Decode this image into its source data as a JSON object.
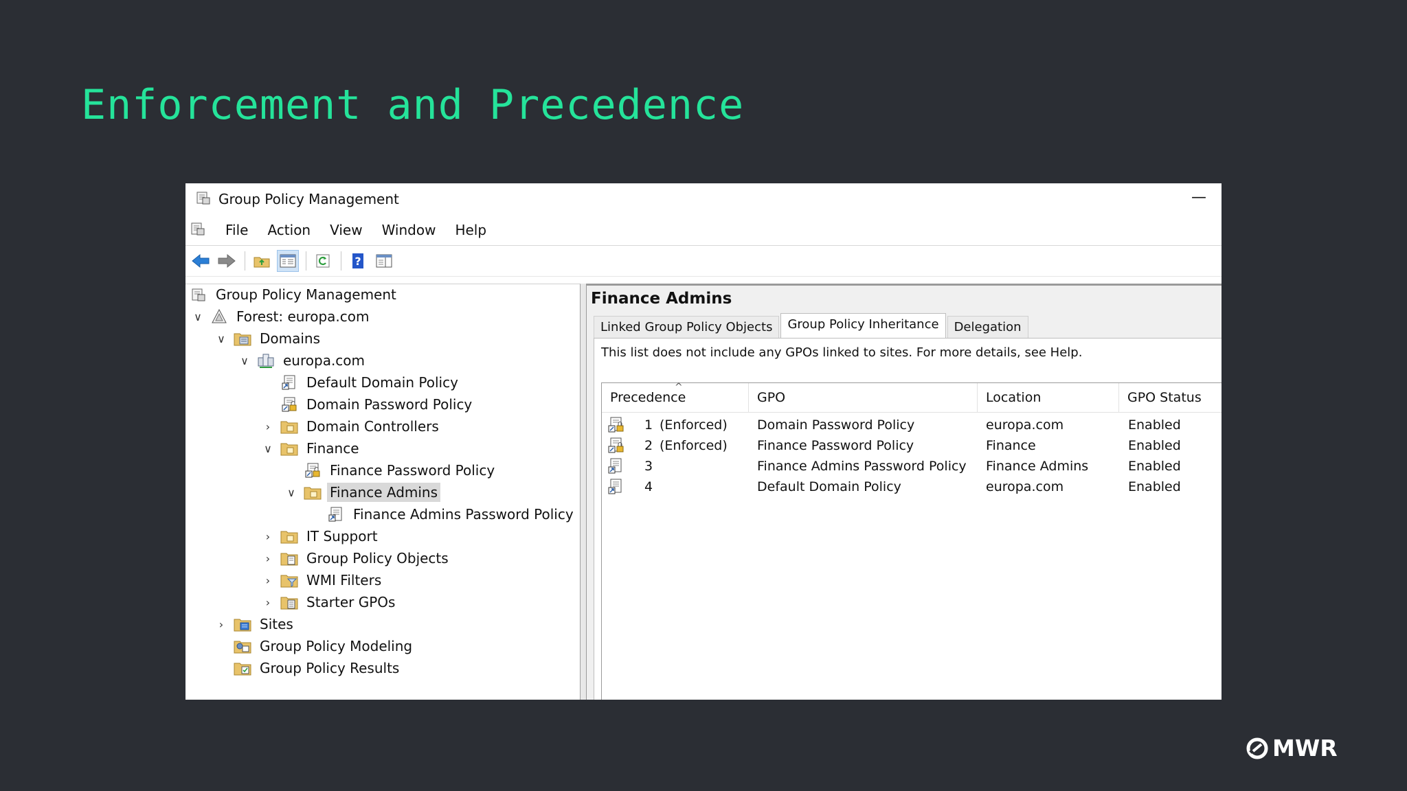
{
  "slide": {
    "title": "Enforcement and Precedence",
    "logo_text": "MWR"
  },
  "window": {
    "title": "Group Policy Management",
    "minimize_glyph": "—",
    "menu": [
      "File",
      "Action",
      "View",
      "Window",
      "Help"
    ]
  },
  "tree": {
    "root": "Group Policy Management",
    "forest": "Forest: europa.com",
    "domains": "Domains",
    "domain": "europa.com",
    "default_domain_policy": "Default Domain Policy",
    "domain_password_policy": "Domain Password Policy",
    "domain_controllers": "Domain Controllers",
    "finance": "Finance",
    "finance_password_policy": "Finance Password Policy",
    "finance_admins": "Finance Admins",
    "finance_admins_password_policy": "Finance Admins Password Policy",
    "it_support": "IT Support",
    "group_policy_objects": "Group Policy Objects",
    "wmi_filters": "WMI Filters",
    "starter_gpos": "Starter GPOs",
    "sites": "Sites",
    "group_policy_modeling": "Group Policy Modeling",
    "group_policy_results": "Group Policy Results"
  },
  "pane": {
    "title": "Finance Admins",
    "tabs": [
      "Linked Group Policy Objects",
      "Group Policy Inheritance",
      "Delegation"
    ],
    "active_tab": "Group Policy Inheritance",
    "note": "This list does not include any GPOs linked to sites. For more details, see Help.",
    "columns": [
      "Precedence",
      "GPO",
      "Location",
      "GPO Status"
    ],
    "rows": [
      {
        "precedence": "1",
        "enforced": "(Enforced)",
        "gpo": "Domain Password Policy",
        "location": "europa.com",
        "status": "Enabled"
      },
      {
        "precedence": "2",
        "enforced": "(Enforced)",
        "gpo": "Finance Password Policy",
        "location": "Finance",
        "status": "Enabled"
      },
      {
        "precedence": "3",
        "enforced": "",
        "gpo": "Finance Admins Password Policy",
        "location": "Finance Admins",
        "status": "Enabled"
      },
      {
        "precedence": "4",
        "enforced": "",
        "gpo": "Default Domain Policy",
        "location": "europa.com",
        "status": "Enabled"
      }
    ]
  },
  "icons": {
    "colors": {
      "folder": "#e8c36a",
      "arrow": "#2b7fd6",
      "accent": "#25e39a",
      "help": "#2456c9"
    }
  }
}
